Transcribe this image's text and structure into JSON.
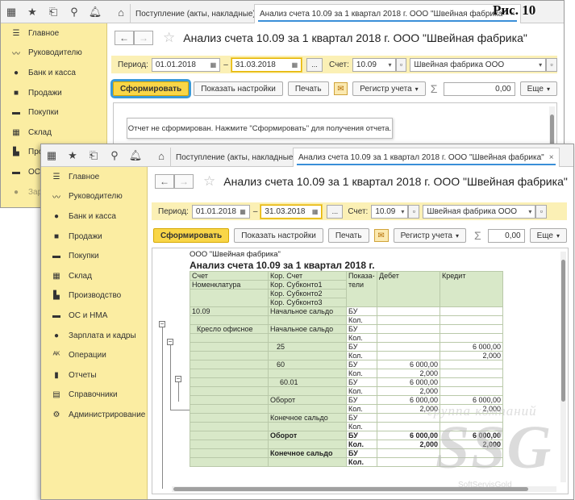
{
  "figure_label": "Рис. 10",
  "app": {
    "tabs": [
      "Поступление (акты, накладные)",
      "Анализ счета 10.09 за 1 квартал 2018 г. ООО \"Швейная фабрика\""
    ],
    "title": "Анализ счета 10.09 за 1 квартал 2018 г. ООО \"Швейная фабрика\"",
    "sidebar": [
      "Главное",
      "Руководителю",
      "Банк и касса",
      "Продажи",
      "Покупки",
      "Склад",
      "Производство",
      "ОС и НМА",
      "Зарплата и кадры",
      "Операции",
      "Отчеты",
      "Справочники",
      "Администрирование"
    ],
    "sidebar_back": [
      "Главное",
      "Руководителю",
      "Банк и касса",
      "Продажи",
      "Покупки",
      "Склад",
      "Про",
      "ОС",
      "Зар"
    ],
    "params": {
      "period_label": "Период:",
      "date_from": "01.01.2018",
      "dash": "–",
      "date_to": "31.03.2018",
      "dots": "...",
      "account_label": "Счет:",
      "account": "10.09",
      "org": "Швейная фабрика ООО"
    },
    "toolbar": {
      "generate": "Сформировать",
      "settings": "Показать настройки",
      "print": "Печать",
      "register": "Регистр учета",
      "sum": "0,00",
      "more": "Еще"
    },
    "message": "Отчет не сформирован. Нажмите \"Сформировать\" для получения отчета."
  },
  "report": {
    "company": "ООО \"Швейная фабрика\"",
    "title": "Анализ счета 10.09 за 1 квартал 2018 г.",
    "headers": {
      "account": "Счет",
      "nomenclature": "Номенклатура",
      "corr": "Кор. Счет",
      "sub1": "Кор. Субконто1",
      "sub2": "Кор. Субконто2",
      "sub3": "Кор. Субконто3",
      "indicators": "Показа-тели",
      "debit": "Дебет",
      "credit": "Кредит"
    },
    "rows": [
      {
        "a": "10.09",
        "b": "Начальное сальдо",
        "ind": "БУ",
        "d": "",
        "c": "",
        "bold": false
      },
      {
        "a": "",
        "b": "",
        "ind": "Кол.",
        "d": "",
        "c": "",
        "bold": false
      },
      {
        "a": "Кресло офисное",
        "b": "Начальное сальдо",
        "ind": "БУ",
        "d": "",
        "c": "",
        "bold": false
      },
      {
        "a": "",
        "b": "",
        "ind": "Кол.",
        "d": "",
        "c": "",
        "bold": false
      },
      {
        "a": "",
        "b": "25",
        "ind": "БУ",
        "d": "",
        "c": "6 000,00",
        "bold": false
      },
      {
        "a": "",
        "b": "",
        "ind": "Кол.",
        "d": "",
        "c": "2,000",
        "bold": false
      },
      {
        "a": "",
        "b": "60",
        "ind": "БУ",
        "d": "6 000,00",
        "c": "",
        "bold": false
      },
      {
        "a": "",
        "b": "",
        "ind": "Кол.",
        "d": "2,000",
        "c": "",
        "bold": false
      },
      {
        "a": "",
        "b": "60.01",
        "ind": "БУ",
        "d": "6 000,00",
        "c": "",
        "bold": false
      },
      {
        "a": "",
        "b": "",
        "ind": "Кол.",
        "d": "2,000",
        "c": "",
        "bold": false
      },
      {
        "a": "",
        "b": "Оборот",
        "ind": "БУ",
        "d": "6 000,00",
        "c": "6 000,00",
        "bold": false
      },
      {
        "a": "",
        "b": "",
        "ind": "Кол.",
        "d": "2,000",
        "c": "2,000",
        "bold": false
      },
      {
        "a": "",
        "b": "Конечное сальдо",
        "ind": "БУ",
        "d": "",
        "c": "",
        "bold": false
      },
      {
        "a": "",
        "b": "",
        "ind": "Кол.",
        "d": "",
        "c": "",
        "bold": false
      },
      {
        "a": "",
        "b": "Оборот",
        "ind": "БУ",
        "d": "6 000,00",
        "c": "6 000,00",
        "bold": true
      },
      {
        "a": "",
        "b": "",
        "ind": "Кол.",
        "d": "2,000",
        "c": "2,000",
        "bold": true
      },
      {
        "a": "",
        "b": "Конечное сальдо",
        "ind": "БУ",
        "d": "",
        "c": "",
        "bold": true
      },
      {
        "a": "",
        "b": "",
        "ind": "Кол.",
        "d": "",
        "c": "",
        "bold": true
      }
    ]
  },
  "watermark": {
    "top": "группа компаний",
    "main": "SSG",
    "bottom": "SoftServisGold"
  }
}
